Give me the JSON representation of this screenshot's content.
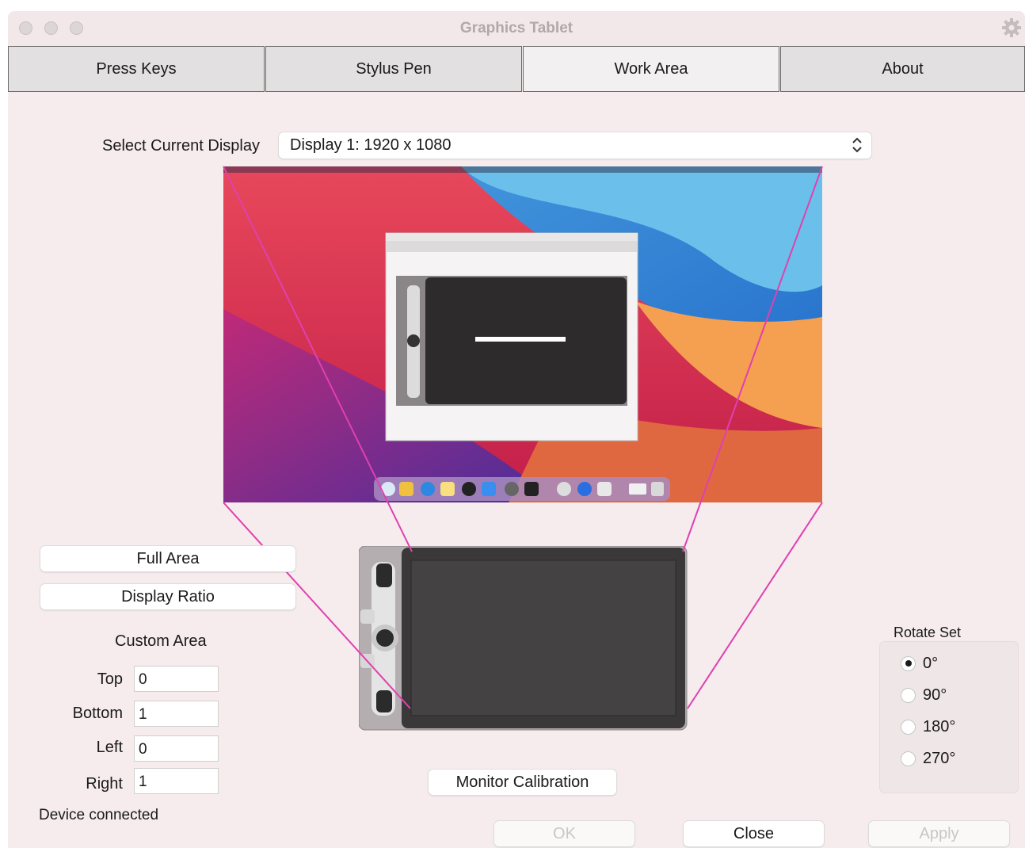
{
  "window": {
    "title": "Graphics Tablet"
  },
  "tabs": [
    {
      "label": "Press Keys"
    },
    {
      "label": "Stylus Pen"
    },
    {
      "label": "Work Area"
    },
    {
      "label": "About"
    }
  ],
  "display": {
    "label": "Select Current Display",
    "selected": "Display 1: 1920 x 1080"
  },
  "area_buttons": {
    "full_area": "Full Area",
    "display_ratio": "Display Ratio"
  },
  "custom_area": {
    "heading": "Custom Area",
    "top_label": "Top",
    "top_value": "0",
    "bottom_label": "Bottom",
    "bottom_value": "1",
    "left_label": "Left",
    "left_value": "0",
    "right_label": "Right",
    "right_value": "1"
  },
  "rotate": {
    "heading": "Rotate Set",
    "options": [
      "0°",
      "90°",
      "180°",
      "270°"
    ],
    "selected": "0°"
  },
  "calibration_button": "Monitor Calibration",
  "status": "Device connected",
  "footer": {
    "ok": "OK",
    "close": "Close",
    "apply": "Apply"
  },
  "colors": {
    "window_bg": "#f6eced",
    "mapping_lines": "#e040b0"
  }
}
